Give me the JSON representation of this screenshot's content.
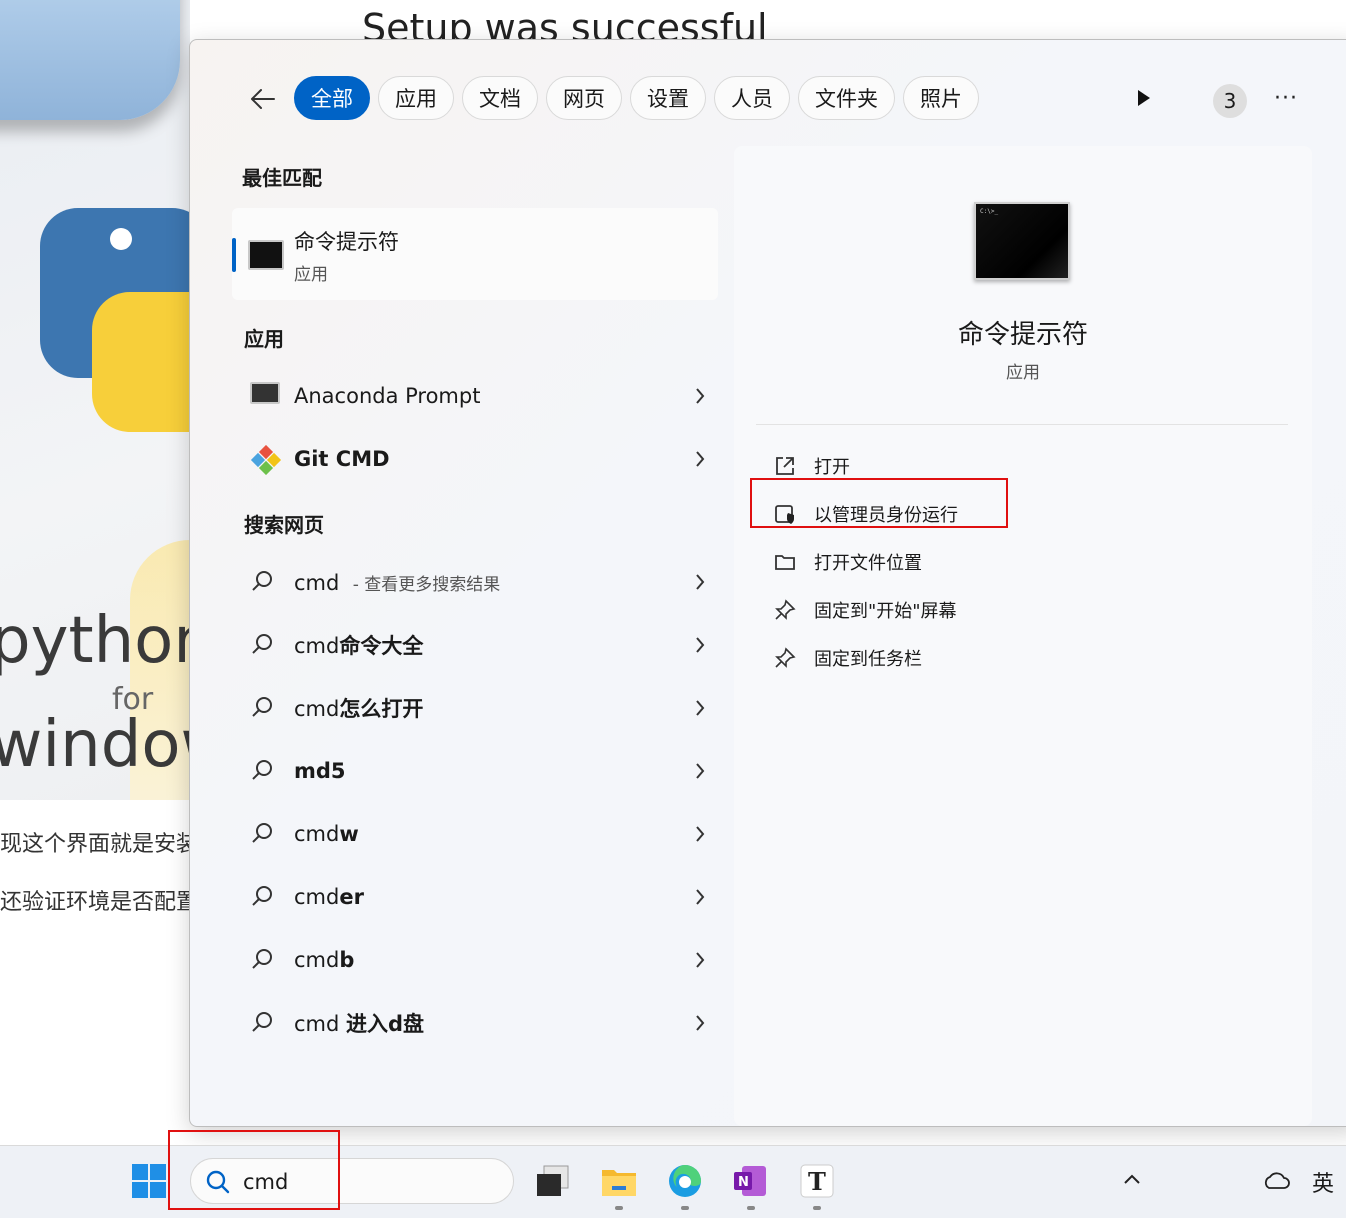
{
  "background": {
    "page_title": "Setup was successful",
    "logo_words": [
      "python",
      "for",
      "window"
    ],
    "text_line_1": "现这个界面就是安装",
    "text_line_2": "还验证环境是否配置"
  },
  "search_panel": {
    "filters": [
      {
        "label": "全部",
        "active": true
      },
      {
        "label": "应用",
        "active": false
      },
      {
        "label": "文档",
        "active": false
      },
      {
        "label": "网页",
        "active": false
      },
      {
        "label": "设置",
        "active": false
      },
      {
        "label": "人员",
        "active": false
      },
      {
        "label": "文件夹",
        "active": false
      },
      {
        "label": "照片",
        "active": false
      }
    ],
    "badge_count": "3",
    "more_label": "···",
    "best_match_heading": "最佳匹配",
    "best_match": {
      "title": "命令提示符",
      "subtitle": "应用"
    },
    "apps_heading": "应用",
    "apps": [
      {
        "label": "Anaconda Prompt"
      },
      {
        "label": "Git CMD"
      }
    ],
    "web_heading": "搜索网页",
    "web_results": [
      {
        "prefix": "cmd",
        "bold": "",
        "suffix": " - 查看更多搜索结果"
      },
      {
        "prefix": "cmd",
        "bold": "命令大全",
        "suffix": ""
      },
      {
        "prefix": "cmd",
        "bold": "怎么打开",
        "suffix": ""
      },
      {
        "prefix": "",
        "bold": "md5",
        "suffix": ""
      },
      {
        "prefix": "cmd",
        "bold": "w",
        "suffix": ""
      },
      {
        "prefix": "cmd",
        "bold": "er",
        "suffix": ""
      },
      {
        "prefix": "cmd",
        "bold": "b",
        "suffix": ""
      },
      {
        "prefix": "cmd ",
        "bold": "进入d盘",
        "suffix": ""
      }
    ],
    "preview": {
      "title": "命令提示符",
      "subtitle": "应用",
      "icon_text": "C:\\>_",
      "actions": [
        {
          "label": "打开",
          "icon": "open-external-icon"
        },
        {
          "label": "以管理员身份运行",
          "icon": "shield-admin-icon"
        },
        {
          "label": "打开文件位置",
          "icon": "folder-icon"
        },
        {
          "label": "固定到\"开始\"屏幕",
          "icon": "pin-icon"
        },
        {
          "label": "固定到任务栏",
          "icon": "pin-icon"
        }
      ]
    }
  },
  "taskbar": {
    "search_value": "cmd",
    "ime_label": "英"
  },
  "colors": {
    "accent": "#0063c6",
    "highlight_box": "#e01010"
  }
}
